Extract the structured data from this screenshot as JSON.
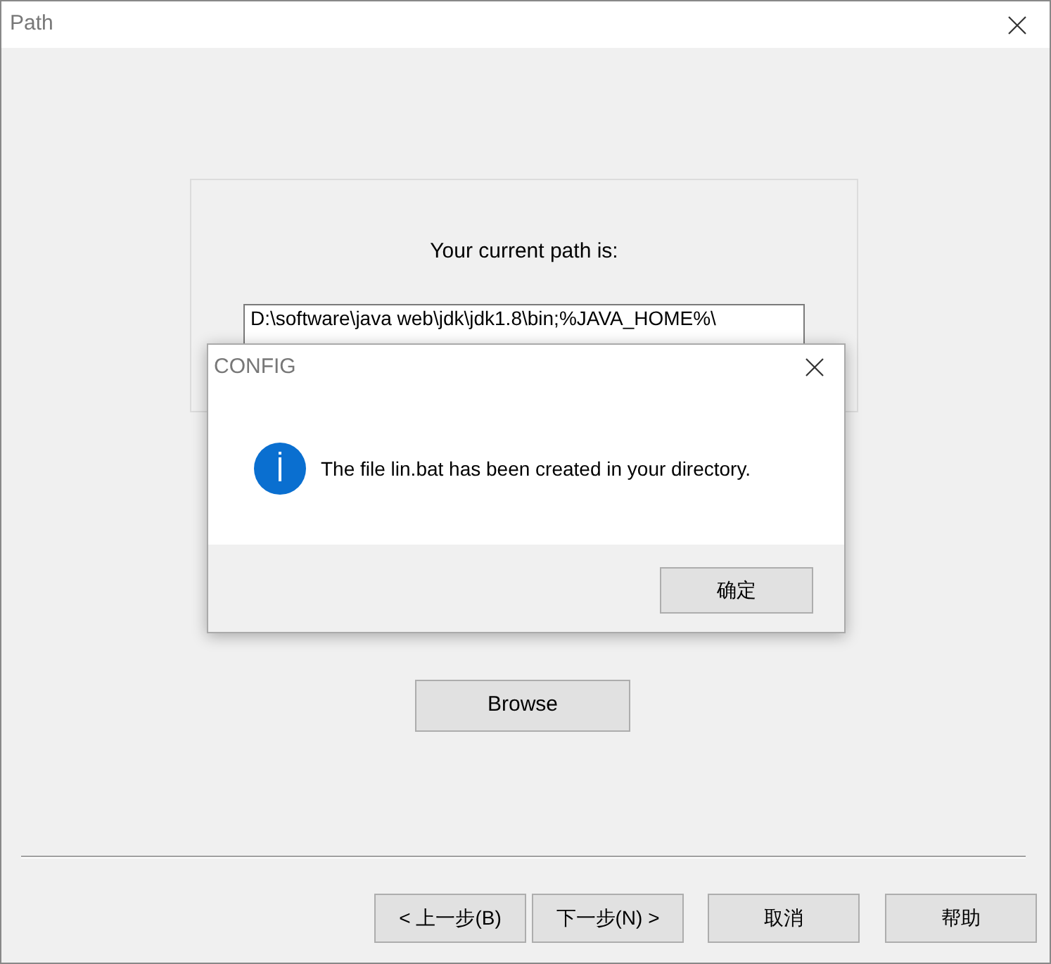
{
  "window": {
    "title": "Path"
  },
  "panel": {
    "label": "Your current path is:",
    "path_value": "D:\\software\\java web\\jdk\\jdk1.8\\bin;%JAVA_HOME%\\"
  },
  "browse_button": "Browse",
  "buttons": [
    "< 上一步(B)",
    "下一步(N) >",
    "取消",
    "帮助"
  ],
  "dialog": {
    "title": "CONFIG",
    "message": "The file lin.bat has been created in your directory.",
    "ok_button": "确定"
  }
}
